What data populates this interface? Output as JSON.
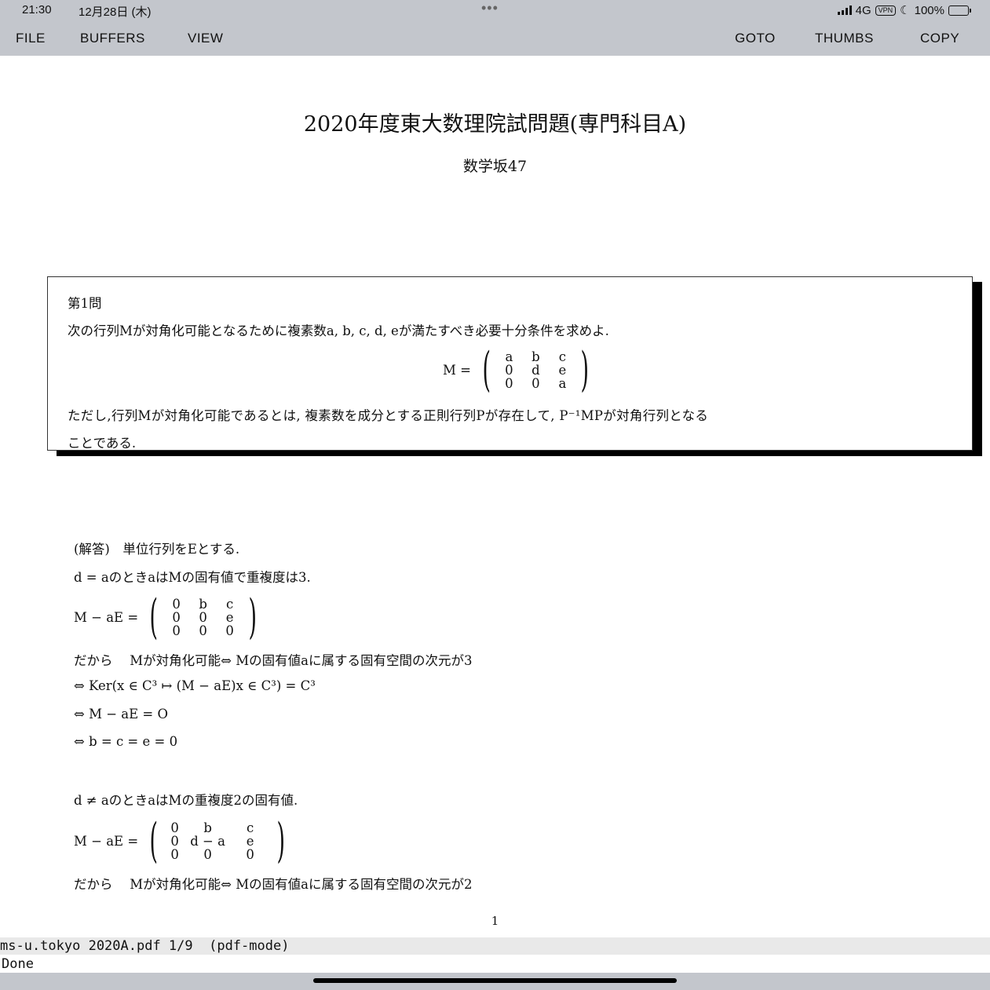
{
  "status_bar": {
    "time": "21:30",
    "date": "12月28日 (木)",
    "dots": "•••",
    "network": "4G",
    "vpn": "VPN",
    "battery": "100%",
    "colors": {
      "battery_fill": "#39c84a"
    }
  },
  "menu": {
    "file": "FILE",
    "buffers": "BUFFERS",
    "view": "VIEW",
    "goto": "GOTO",
    "thumbs": "THUMBS",
    "copy": "COPY"
  },
  "document": {
    "title": "2020年度東大数理院試問題(専門科目A)",
    "author": "数学坂47",
    "problem": {
      "heading": "第1問",
      "line1": "次の行列Mが対角化可能となるために複素数a, b, c, d, eが満たすべき必要十分条件を求めよ.",
      "matrix_lhs": "M =",
      "matrix": [
        [
          "a",
          "b",
          "c"
        ],
        [
          "0",
          "d",
          "e"
        ],
        [
          "0",
          "0",
          "a"
        ]
      ],
      "line2": "ただし,行列Mが対角化可能であるとは, 複素数を成分とする正則行列Pが存在して, P⁻¹MPが対角行列となる",
      "line3": "ことである."
    },
    "solution": {
      "intro": "(解答)　単位行列をEとする.",
      "case1": "d = aのときaはMの固有値で重複度は3.",
      "matrix1_lhs": "M − aE =",
      "matrix1": [
        [
          "0",
          "b",
          "c"
        ],
        [
          "0",
          "0",
          "e"
        ],
        [
          "0",
          "0",
          "0"
        ]
      ],
      "step1": "だから　 Mが対角化可能⇔ Mの固有値aに属する固有空間の次元が3",
      "step2": "⇔ Ker(x ∈ C³ ↦ (M − aE)x ∈ C³) = C³",
      "step3": "⇔ M − aE = O",
      "step4": "⇔ b = c = e = 0",
      "case2": "d ≠ aのときaはMの重複度2の固有値.",
      "matrix2_lhs": "M − aE =",
      "matrix2": [
        [
          "0",
          "b",
          "c"
        ],
        [
          "0",
          "d − a",
          "e"
        ],
        [
          "0",
          "0",
          "0"
        ]
      ],
      "step5": "だから　 Mが対角化可能⇔ Mの固有値aに属する固有空間の次元が2"
    },
    "page_number": "1"
  },
  "modeline": "ms-u.tokyo 2020A.pdf 1/9  (pdf-mode)",
  "echo": "Done"
}
